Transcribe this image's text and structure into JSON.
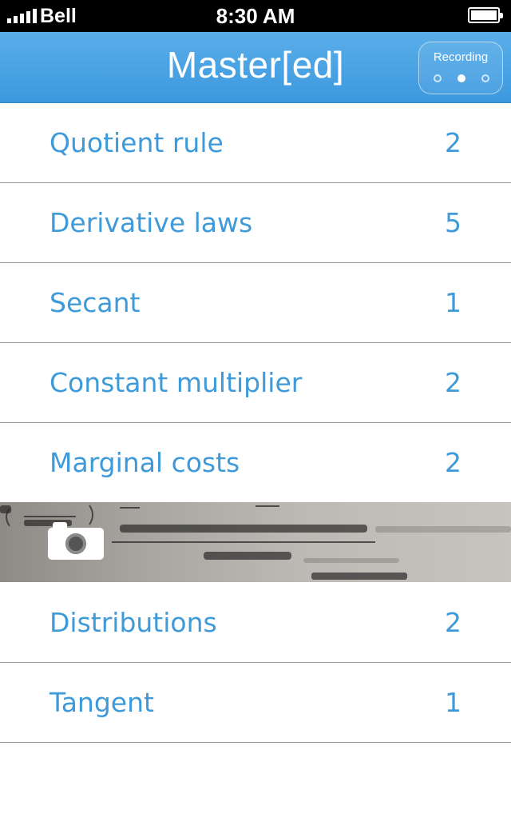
{
  "status_bar": {
    "carrier": "Bell",
    "time": "8:30 AM"
  },
  "header": {
    "title": "Master[ed]",
    "recording_label": "Recording",
    "page_dots": 3,
    "active_dot": 2
  },
  "topics": [
    {
      "label": "Quotient rule",
      "count": "2"
    },
    {
      "label": "Derivative laws",
      "count": "5"
    },
    {
      "label": "Secant",
      "count": "1"
    },
    {
      "label": "Constant multiplier",
      "count": "2"
    },
    {
      "label": "Marginal costs",
      "count": "2"
    },
    {
      "label": "Distributions",
      "count": "2"
    },
    {
      "label": "Tangent",
      "count": "1"
    }
  ],
  "photo_entry": {
    "icon": "camera-icon"
  },
  "colors": {
    "accent": "#3e9ad8",
    "header": "#4aa3e4"
  }
}
